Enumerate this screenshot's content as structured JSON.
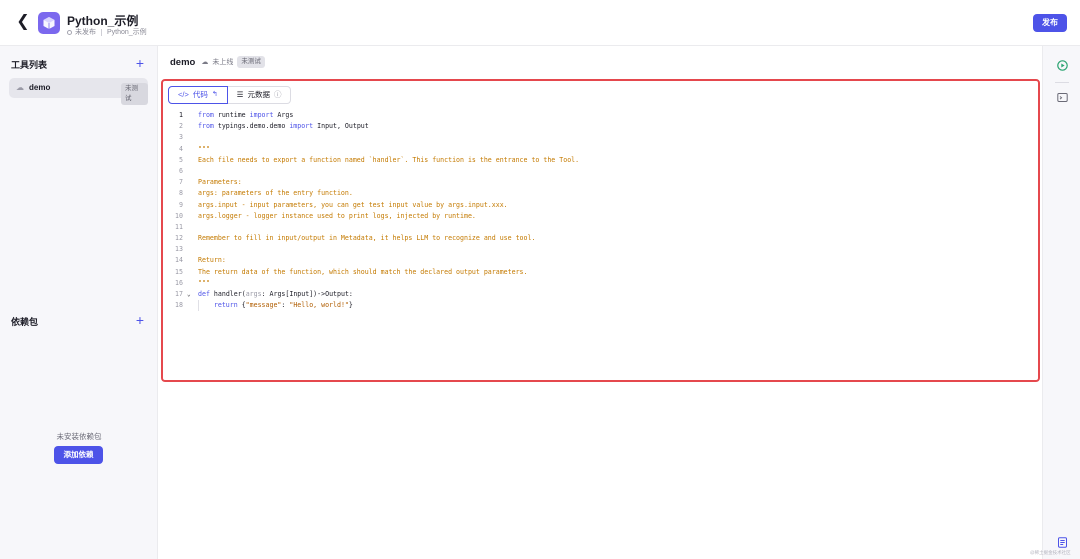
{
  "header": {
    "back_icon": "chevron-left-icon",
    "app_title": "Python_示例",
    "status": "未发布",
    "breadcrumb": "Python_示例",
    "publish_label": "发布",
    "accent": "#4d53e8"
  },
  "sidebar": {
    "tools_title": "工具列表",
    "tool_items": [
      {
        "name": "demo",
        "badge": "未测试"
      }
    ],
    "deps_title": "依赖包",
    "empty_text": "未安装依赖包",
    "add_dep_label": "添加依赖"
  },
  "main": {
    "title": "demo",
    "online_status": "未上线",
    "test_badge": "未测试",
    "tabs": [
      {
        "label": "代码",
        "active": true
      },
      {
        "label": "元数据",
        "active": false
      }
    ],
    "code_lines": [
      "from runtime import Args",
      "from typings.demo.demo import Input, Output",
      "",
      "\"\"\"",
      "Each file needs to export a function named `handler`. This function is the entrance to the Tool.",
      "",
      "Parameters:",
      "args: parameters of the entry function.",
      "args.input - input parameters, you can get test input value by args.input.xxx.",
      "args.logger - logger instance used to print logs, injected by runtime.",
      "",
      "Remember to fill in input/output in Metadata, it helps LLM to recognize and use tool.",
      "",
      "Return:",
      "The return data of the function, which should match the declared output parameters.",
      "\"\"\"",
      "def handler(args: Args[Input])->Output:",
      "    return {\"message\": \"Hello, world!\"}"
    ]
  },
  "rightbar": {
    "icons": [
      "run-icon",
      "terminal-icon",
      "log-icon"
    ]
  },
  "watermark": "@稀土掘金技术社区"
}
